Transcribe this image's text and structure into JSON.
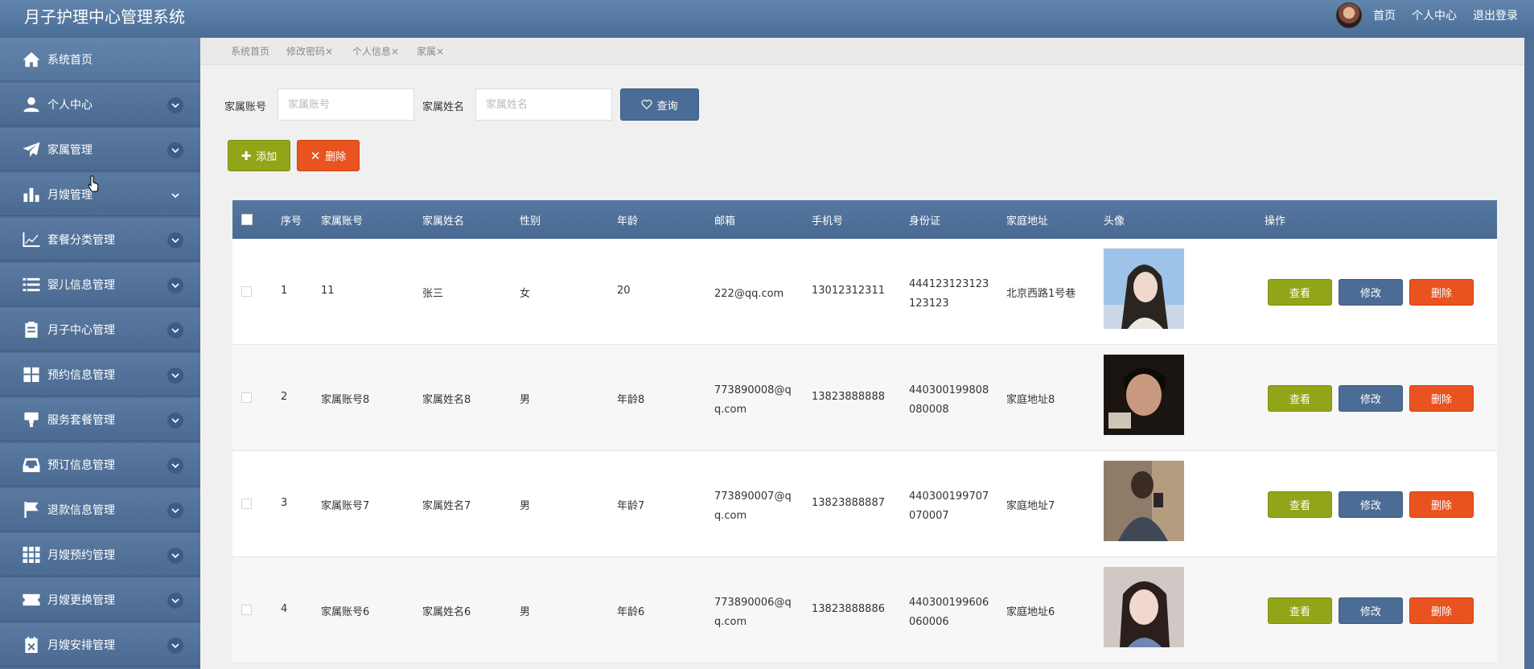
{
  "app": {
    "title": "月子护理中心管理系统"
  },
  "topnav": {
    "links": [
      "首页",
      "个人中心",
      "退出登录"
    ]
  },
  "sidebar": {
    "items": [
      {
        "label": "系统首页",
        "icon": "home-icon",
        "chevron": false
      },
      {
        "label": "个人中心",
        "icon": "user-icon",
        "chevron": true
      },
      {
        "label": "家属管理",
        "icon": "paper-plane-icon",
        "chevron": true
      },
      {
        "label": "月嫂管理",
        "icon": "bar-chart-icon",
        "chevron": true
      },
      {
        "label": "套餐分类管理",
        "icon": "line-chart-icon",
        "chevron": true
      },
      {
        "label": "婴儿信息管理",
        "icon": "list-icon",
        "chevron": true
      },
      {
        "label": "月子中心管理",
        "icon": "clipboard-icon",
        "chevron": true
      },
      {
        "label": "预约信息管理",
        "icon": "grid-icon",
        "chevron": true
      },
      {
        "label": "服务套餐管理",
        "icon": "stamp-icon",
        "chevron": true
      },
      {
        "label": "预订信息管理",
        "icon": "tray-icon",
        "chevron": true
      },
      {
        "label": "退款信息管理",
        "icon": "flag-icon",
        "chevron": true
      },
      {
        "label": "月嫂预约管理",
        "icon": "apps-icon",
        "chevron": true
      },
      {
        "label": "月嫂更换管理",
        "icon": "ticket-icon",
        "chevron": true
      },
      {
        "label": "月嫂安排管理",
        "icon": "calendar-x-icon",
        "chevron": true
      }
    ]
  },
  "breadcrumb": {
    "tabs": [
      "系统首页",
      "修改密码×",
      "个人信息×",
      "家属×"
    ]
  },
  "search": {
    "account_label": "家属账号",
    "account_placeholder": "家属账号",
    "name_label": "家属姓名",
    "name_placeholder": "家属姓名",
    "query_label": "查询"
  },
  "actions": {
    "add_label": "添加",
    "delete_label": "删除"
  },
  "table": {
    "headers": [
      "序号",
      "家属账号",
      "家属姓名",
      "性别",
      "年龄",
      "邮箱",
      "手机号",
      "身份证",
      "家庭地址",
      "头像",
      "操作"
    ],
    "row_actions": {
      "view": "查看",
      "edit": "修改",
      "delete": "删除"
    },
    "rows": [
      {
        "no": "1",
        "account": "11",
        "name": "张三",
        "gender": "女",
        "age": "20",
        "email_1": "222@qq.com",
        "email_2": "",
        "phone": "13012312311",
        "id_1": "444123123123",
        "id_2": "123123",
        "address": "北京西路1号巷",
        "avatar": "avatar-photo-1"
      },
      {
        "no": "2",
        "account": "家属账号8",
        "name": "家属姓名8",
        "gender": "男",
        "age": "年龄8",
        "email_1": "773890008@q",
        "email_2": "q.com",
        "phone": "13823888888",
        "id_1": "440300199808",
        "id_2": "080008",
        "address": "家庭地址8",
        "avatar": "avatar-photo-2"
      },
      {
        "no": "3",
        "account": "家属账号7",
        "name": "家属姓名7",
        "gender": "男",
        "age": "年龄7",
        "email_1": "773890007@q",
        "email_2": "q.com",
        "phone": "13823888887",
        "id_1": "440300199707",
        "id_2": "070007",
        "address": "家庭地址7",
        "avatar": "avatar-photo-3"
      },
      {
        "no": "4",
        "account": "家属账号6",
        "name": "家属姓名6",
        "gender": "男",
        "age": "年龄6",
        "email_1": "773890006@q",
        "email_2": "q.com",
        "phone": "13823888886",
        "id_1": "440300199606",
        "id_2": "060006",
        "address": "家庭地址6",
        "avatar": "avatar-photo-4"
      }
    ]
  },
  "colors": {
    "header": "#4a6d96",
    "sidebar": "#4e6e95",
    "green": "#92a518",
    "blue": "#4b6c94",
    "orange": "#e8531f"
  }
}
